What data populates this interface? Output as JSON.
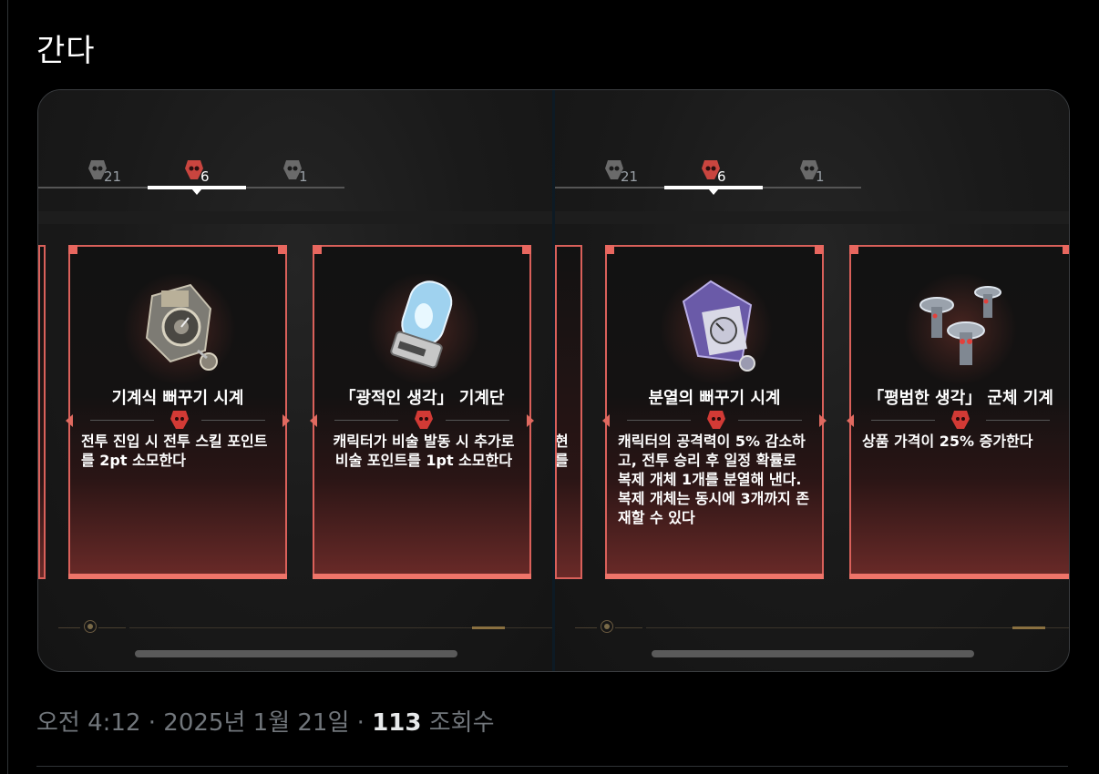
{
  "post": {
    "text": "간다"
  },
  "tabs": {
    "counts": [
      "21",
      "6",
      "1"
    ]
  },
  "cards": [
    {
      "name": "기계식 뻐꾸기 시계",
      "desc": "전투 진입 시 전투 스킬 포인트를 2pt 소모한다"
    },
    {
      "name": "「광적인 생각」 기계단",
      "desc": "캐릭터가 비술 발동 시 추가로 비술 포인트를 1pt 소모한다"
    },
    {
      "name": "분열의 뻐꾸기 시계",
      "desc": "캐릭터의 공격력이 5% 감소하고, 전투 승리 후 일정 확률로 복제 개체 1개를 분열해 낸다. 복제 개체는 동시에 3개까지 존재할 수 있다"
    },
    {
      "name": "「평범한 생각」 군체 기계",
      "desc": "상품 가격이 25% 증가한다"
    }
  ],
  "peek": {
    "lines": [
      "현",
      "를"
    ]
  },
  "meta": {
    "time": "오전 4:12",
    "sep": "·",
    "date": "2025년 1월 21일",
    "views_count": "113",
    "views_label": "조회수"
  },
  "colors": {
    "accent": "#e8675f",
    "background": "#000000",
    "text": "#e7e9ea",
    "muted": "#71767b"
  },
  "icons": [
    "cuckoo-clock-art",
    "glass-jar-art",
    "split-cuckoo-clock-art",
    "swarm-robots-art",
    "faction-emblem-icon"
  ]
}
